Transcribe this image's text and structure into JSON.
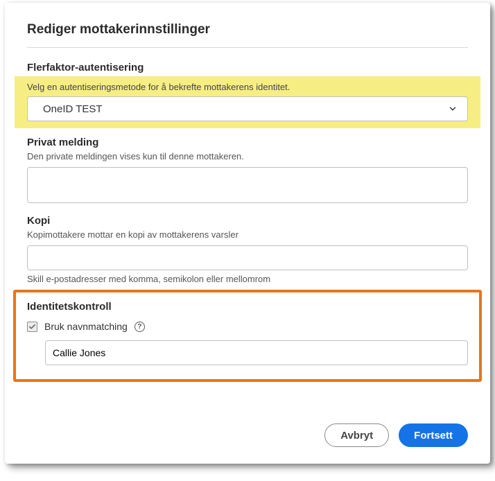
{
  "title": "Rediger mottakerinnstillinger",
  "mfa": {
    "label": "Flerfaktor-autentisering",
    "help": "Velg en autentiseringsmetode for å bekrefte mottakerens identitet.",
    "selected": "OneID TEST"
  },
  "privateMessage": {
    "label": "Privat melding",
    "help": "Den private meldingen vises kun til denne mottakeren.",
    "value": ""
  },
  "copy": {
    "label": "Kopi",
    "help": "Kopimottakere mottar en kopi av mottakerens varsler",
    "value": "",
    "subHelp": "Skill e-postadresser med komma, semikolon eller mellomrom"
  },
  "identity": {
    "label": "Identitetskontroll",
    "nameMatchLabel": "Bruk navnmatching",
    "nameMatchChecked": true,
    "nameValue": "Callie Jones"
  },
  "footer": {
    "cancel": "Avbryt",
    "continue": "Fortsett"
  }
}
